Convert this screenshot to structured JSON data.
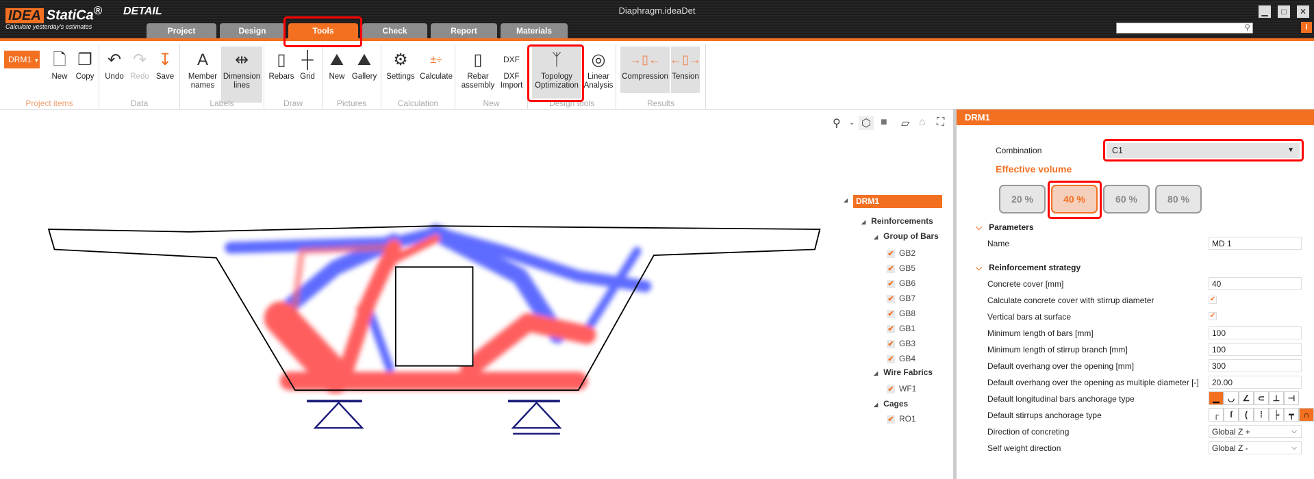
{
  "app": {
    "logo": "IDEA StatiCa",
    "logo_suffix": "®",
    "product": "DETAIL",
    "tagline": "Calculate yesterday's estimates",
    "window_title": "Diaphragm.ideaDet",
    "search_placeholder": "",
    "window_buttons": [
      "▁",
      "□",
      "✕"
    ],
    "info": "i"
  },
  "tabs": [
    {
      "label": "Project"
    },
    {
      "label": "Design"
    },
    {
      "label": "Tools",
      "active": true
    },
    {
      "label": "Check"
    },
    {
      "label": "Report"
    },
    {
      "label": "Materials"
    }
  ],
  "ribbon": {
    "item_selector": "DRM1",
    "groups": [
      "Project items",
      "Data",
      "Labels",
      "Draw",
      "Pictures",
      "Calculation",
      "New",
      "Design tools",
      "Results"
    ],
    "buttons": {
      "new": "New",
      "copy": "Copy",
      "undo": "Undo",
      "redo": "Redo",
      "save": "Save",
      "member_names": [
        "Member",
        "names"
      ],
      "dimension_lines": [
        "Dimension",
        "lines"
      ],
      "rebars": "Rebars",
      "grid": "Grid",
      "pic_new": "New",
      "gallery": "Gallery",
      "settings": "Settings",
      "calculate": "Calculate",
      "rebar_assembly": [
        "Rebar",
        "assembly"
      ],
      "dxf_import": [
        "DXF",
        "Import"
      ],
      "topology": [
        "Topology",
        "Optimization"
      ],
      "linear": [
        "Linear",
        "Analysis"
      ],
      "compression": "Compression",
      "tension": "Tension"
    }
  },
  "tree": {
    "root": "DRM1",
    "reinforcements": "Reinforcements",
    "group_of_bars": "Group of Bars",
    "bars": [
      "GB2",
      "GB5",
      "GB6",
      "GB7",
      "GB8",
      "GB1",
      "GB3",
      "GB4"
    ],
    "wire_fabrics": "Wire Fabrics",
    "fabrics": [
      "WF1"
    ],
    "cages": "Cages",
    "cage_items": [
      "RO1"
    ]
  },
  "panel": {
    "title": "DRM1",
    "combination_label": "Combination",
    "combination_value": "C1",
    "effective_volume_label": "Effective volume",
    "volumes": [
      "20 %",
      "40 %",
      "60 %",
      "80 %"
    ],
    "selected_volume": "40 %",
    "parameters_label": "Parameters",
    "name_label": "Name",
    "name_value": "MD 1",
    "strategy_label": "Reinforcement strategy",
    "concrete_cover_label": "Concrete cover [mm]",
    "concrete_cover": "40",
    "calc_cover_label": "Calculate concrete cover with stirrup diameter",
    "calc_cover": true,
    "vertical_bars_label": "Vertical bars at surface",
    "vertical_bars": true,
    "min_len_bars_label": "Minimum length of bars [mm]",
    "min_len_bars": "100",
    "min_len_stirrup_label": "Minimum length of stirrup branch [mm]",
    "min_len_stirrup": "100",
    "overhang_label": "Default overhang over the opening [mm]",
    "overhang": "300",
    "overhang_mult_label": "Default overhang over the opening as multiple diameter [-]",
    "overhang_mult": "20.00",
    "long_anchor_label": "Default longitudinal bars anchorage type",
    "stirrup_anchor_label": "Default stirrups anchorage type",
    "concreting_label": "Direction of concreting",
    "concreting": "Global Z +",
    "self_weight_label": "Self weight direction",
    "self_weight": "Global Z -"
  },
  "colors": {
    "accent": "#f37021",
    "compression": "#ff4d4d",
    "tension": "#4d5bff",
    "highlight": "#ff0000"
  }
}
